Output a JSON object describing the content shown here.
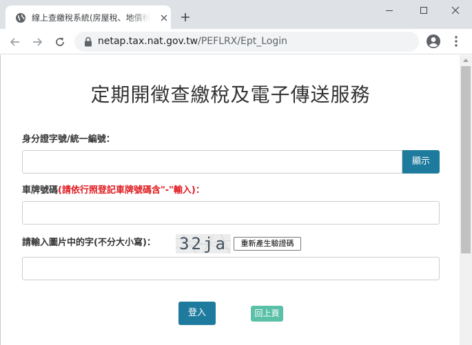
{
  "browser": {
    "tab_title": "線上查繳稅系統(房屋稅、地價稅",
    "url_host": "netap.tax.nat.gov.tw",
    "url_path": "/PEFLRX/Ept_Login"
  },
  "page": {
    "title": "定期開徵查繳稅及電子傳送服務",
    "id_label": "身分證字號/統一編號：",
    "show_button": "顯示",
    "plate_label": "車牌號碼",
    "plate_hint": "(請依行照登記車牌號碼含\"-\"輸入)：",
    "captcha_label": "請輸入圖片中的字(不分大小寫)：",
    "captcha_text": "32ja",
    "refresh_button": "重新產生驗證碼",
    "login_button": "登入",
    "back_button": "回上頁"
  },
  "colors": {
    "primary_button": "#1e7b9e",
    "secondary_button": "#5bc0a8",
    "warning_text": "#e0191e"
  },
  "icons": [
    "globe-icon",
    "close-icon",
    "plus-icon",
    "minimize-icon",
    "maximize-icon",
    "window-close-icon",
    "back-arrow-icon",
    "forward-arrow-icon",
    "reload-icon",
    "lock-icon",
    "profile-icon",
    "menu-icon"
  ]
}
